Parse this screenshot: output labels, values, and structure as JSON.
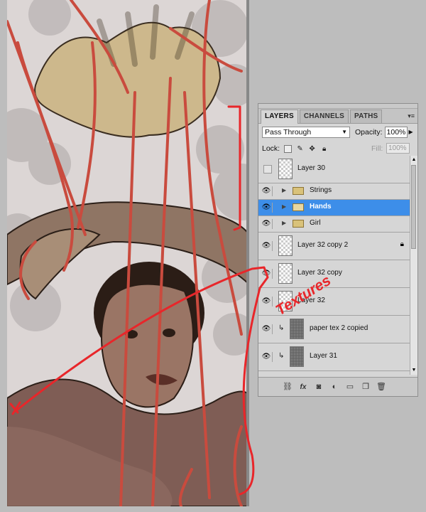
{
  "panel": {
    "tabs": [
      "LAYERS",
      "CHANNELS",
      "PATHS"
    ],
    "blend_mode": "Pass Through",
    "opacity_label": "Opacity:",
    "opacity_value": "100%",
    "lock_label": "Lock:",
    "fill_label": "Fill:",
    "fill_value": "100%",
    "layers": [
      {
        "name": "Layer 30",
        "type": "layer",
        "visible": false
      },
      {
        "name": "Strings",
        "type": "group",
        "visible": true
      },
      {
        "name": "Hands",
        "type": "group",
        "visible": true,
        "selected": true
      },
      {
        "name": "Girl",
        "type": "group",
        "visible": true
      },
      {
        "name": "Layer 32 copy 2",
        "type": "layer",
        "visible": true,
        "locked": true
      },
      {
        "name": "Layer 32 copy",
        "type": "layer",
        "visible": true
      },
      {
        "name": "Layer 32",
        "type": "layer",
        "visible": true
      },
      {
        "name": "paper tex 2 copied",
        "type": "texture",
        "visible": true
      },
      {
        "name": "Layer 31",
        "type": "texture",
        "visible": true
      }
    ]
  },
  "annotation": {
    "text": "Textures",
    "color": "#e8262a"
  },
  "icons": [
    "eye-icon",
    "folder-icon",
    "lock-icon",
    "link-icon",
    "fx-icon",
    "mask-icon",
    "adjustment-icon",
    "new-group-icon",
    "new-layer-icon",
    "trash-icon"
  ]
}
